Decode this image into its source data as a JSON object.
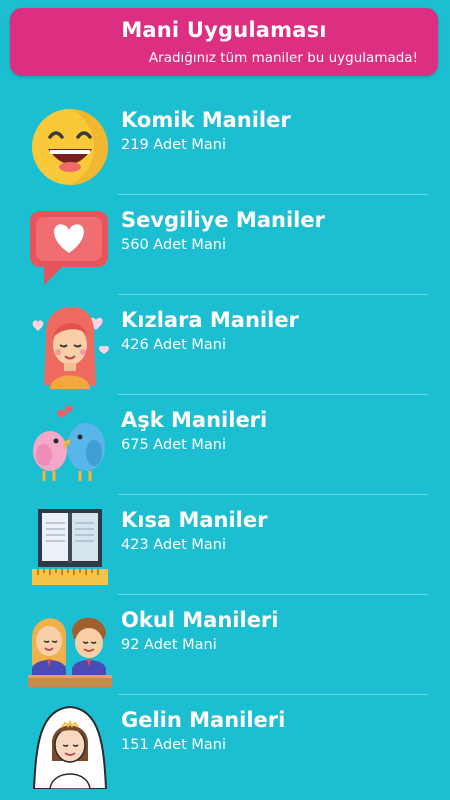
{
  "header": {
    "title": "Mani Uygulaması",
    "subtitle": "Aradığınız tüm maniler bu uygulamada!"
  },
  "categories": [
    {
      "name": "Komik Maniler",
      "count": "219 Adet Mani",
      "icon": "laughing-face-icon"
    },
    {
      "name": "Sevgiliye Maniler",
      "count": "560 Adet Mani",
      "icon": "heart-message-icon"
    },
    {
      "name": "Kızlara Maniler",
      "count": "426 Adet Mani",
      "icon": "girl-icon"
    },
    {
      "name": "Aşk Manileri",
      "count": "675 Adet Mani",
      "icon": "love-birds-icon"
    },
    {
      "name": "Kısa Maniler",
      "count": "423 Adet Mani",
      "icon": "book-ruler-icon"
    },
    {
      "name": "Okul Manileri",
      "count": "92 Adet Mani",
      "icon": "students-icon"
    },
    {
      "name": "Gelin Manileri",
      "count": "151 Adet Mani",
      "icon": "bride-icon"
    }
  ],
  "colors": {
    "background": "#1cbfd1",
    "header": "#dc2f82"
  }
}
